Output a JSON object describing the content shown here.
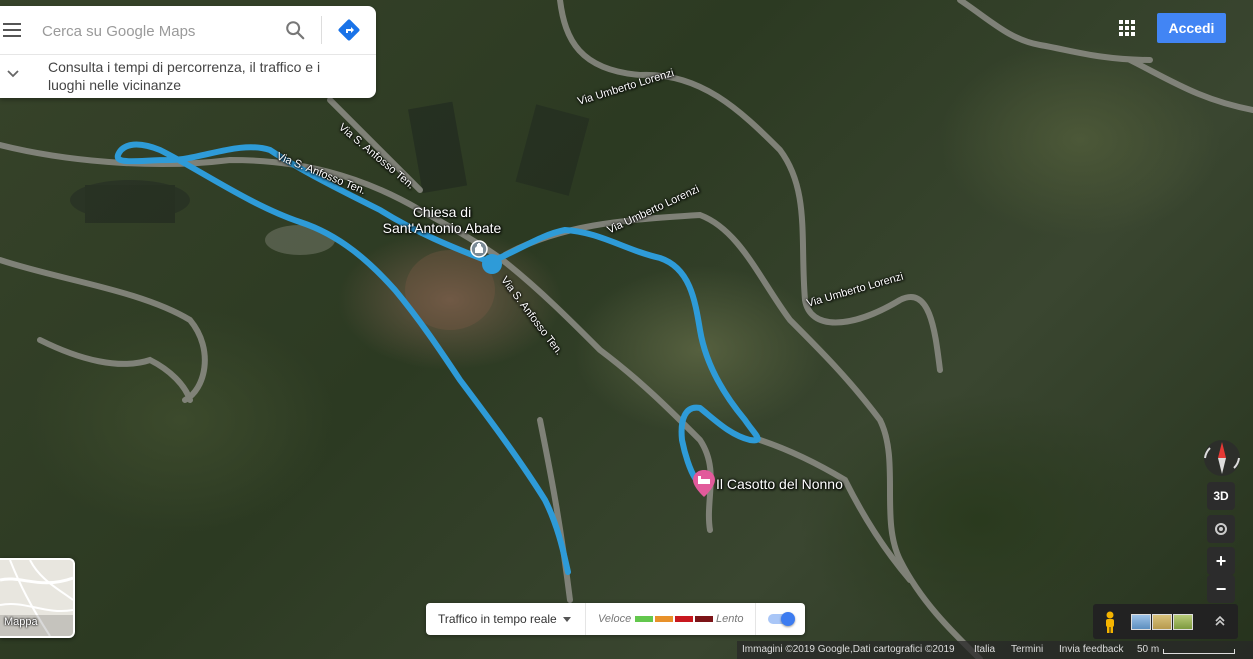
{
  "search": {
    "placeholder": "Cerca su Google Maps",
    "info_text": "Consulta i tempi di percorrenza, il traffico e i luoghi nelle vicinanze"
  },
  "header": {
    "signin_label": "Accedi"
  },
  "map": {
    "places": [
      {
        "name": "Chiesa di Sant'Antonio Abate",
        "line1": "Chiesa di",
        "line2": "Sant'Antonio Abate",
        "type": "church"
      },
      {
        "name": "Il Casotto del Nonno",
        "type": "lodging"
      }
    ],
    "streets": [
      "Via S. Anfosso Ten.",
      "Via S. Anfosso Ten.",
      "Via Umberto Lorenzi",
      "Via Umberto Lorenzi",
      "Via Umberto Lorenzi",
      "Via S. Anfosso Ten."
    ],
    "route_color": "#2e9bd8"
  },
  "layer_switcher": {
    "label": "Mappa"
  },
  "traffic": {
    "label": "Traffico in tempo reale",
    "fast_label": "Veloce",
    "slow_label": "Lento",
    "colors": [
      "#63c74d",
      "#e8912a",
      "#c8181f",
      "#7c1418"
    ],
    "enabled": true
  },
  "controls": {
    "view3d_label": "3D",
    "zoom_in": "+",
    "zoom_out": "−"
  },
  "footer": {
    "imagery": "Immagini ©2019 Google,Dati cartografici ©2019",
    "country": "Italia",
    "terms": "Termini",
    "feedback": "Invia feedback",
    "scale": "50 m"
  }
}
